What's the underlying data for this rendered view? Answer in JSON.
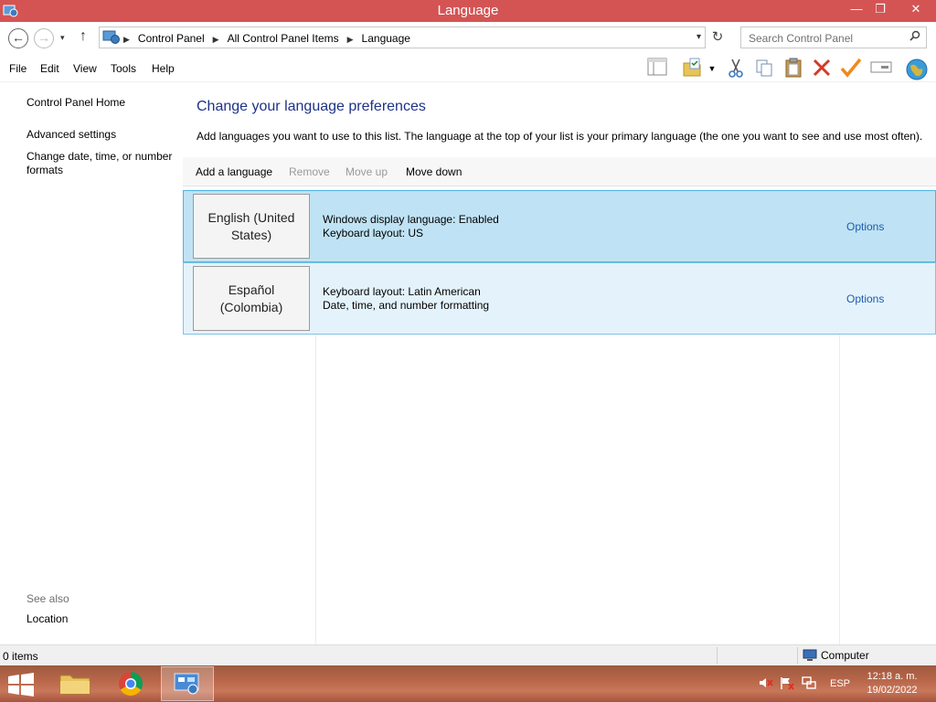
{
  "window": {
    "title": "Language",
    "minimize": "—",
    "restore": "❐",
    "close": "✕"
  },
  "address_bar": {
    "back": "←",
    "forward": "→",
    "dropdown": "▾",
    "up": "↑",
    "breadcrumbs": [
      "Control Panel",
      "All Control Panel Items",
      "Language"
    ],
    "separator": "▶",
    "refresh": "↻",
    "search_placeholder": "Search Control Panel",
    "search_icon": "🔍"
  },
  "menu": [
    "File",
    "Edit",
    "View",
    "Tools",
    "Help"
  ],
  "toolbar_icons": [
    "layout-icon",
    "properties-icon",
    "cut-icon",
    "copy-icon",
    "paste-icon",
    "delete-icon",
    "check-icon",
    "rename-icon",
    "globe-icon"
  ],
  "left_nav": {
    "home": "Control Panel Home",
    "advanced": "Advanced settings",
    "date_formats": "Change date, time, or number formats",
    "see_also": "See also",
    "location": "Location"
  },
  "main": {
    "heading": "Change your language preferences",
    "description": "Add languages you want to use to this list. The language at the top of your list is your primary language (the one you want to see and use most often).",
    "commands": {
      "add": "Add a language",
      "remove": "Remove",
      "move_up": "Move up",
      "move_down": "Move down"
    },
    "languages": [
      {
        "name": "English (United States)",
        "line1": "Windows display language: Enabled",
        "line2": "Keyboard layout: US",
        "options": "Options"
      },
      {
        "name": "Español (Colombia)",
        "line1": "Keyboard layout: Latin American",
        "line2": "Date, time, and number formatting",
        "options": "Options"
      }
    ]
  },
  "status_bar": {
    "items": "0 items",
    "computer": "Computer"
  },
  "taskbar": {
    "input_language": "ESP",
    "time": "12:18 a. m.",
    "date": "19/02/2022"
  },
  "colors": {
    "titlebar": "#d45454",
    "heading": "#1e3287",
    "link": "#1e5bb0",
    "selected_row": "#bfe3f4"
  }
}
